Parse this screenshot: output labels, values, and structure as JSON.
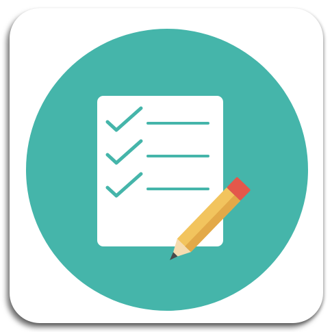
{
  "app_icon": {
    "name": "checklist-app-icon",
    "colors": {
      "tile_background": "#ffffff",
      "circle": "#45b5aa",
      "paper": "#ffffff",
      "check_and_lines": "#45b5aa",
      "pencil_body": "#f2c45e",
      "pencil_body_shade": "#e3a948",
      "pencil_eraser": "#e4574b",
      "pencil_wood": "#f6dcb0",
      "pencil_tip": "#4a4a4a"
    },
    "checklist": {
      "item_count": 3,
      "checked": [
        true,
        true,
        true
      ]
    }
  }
}
